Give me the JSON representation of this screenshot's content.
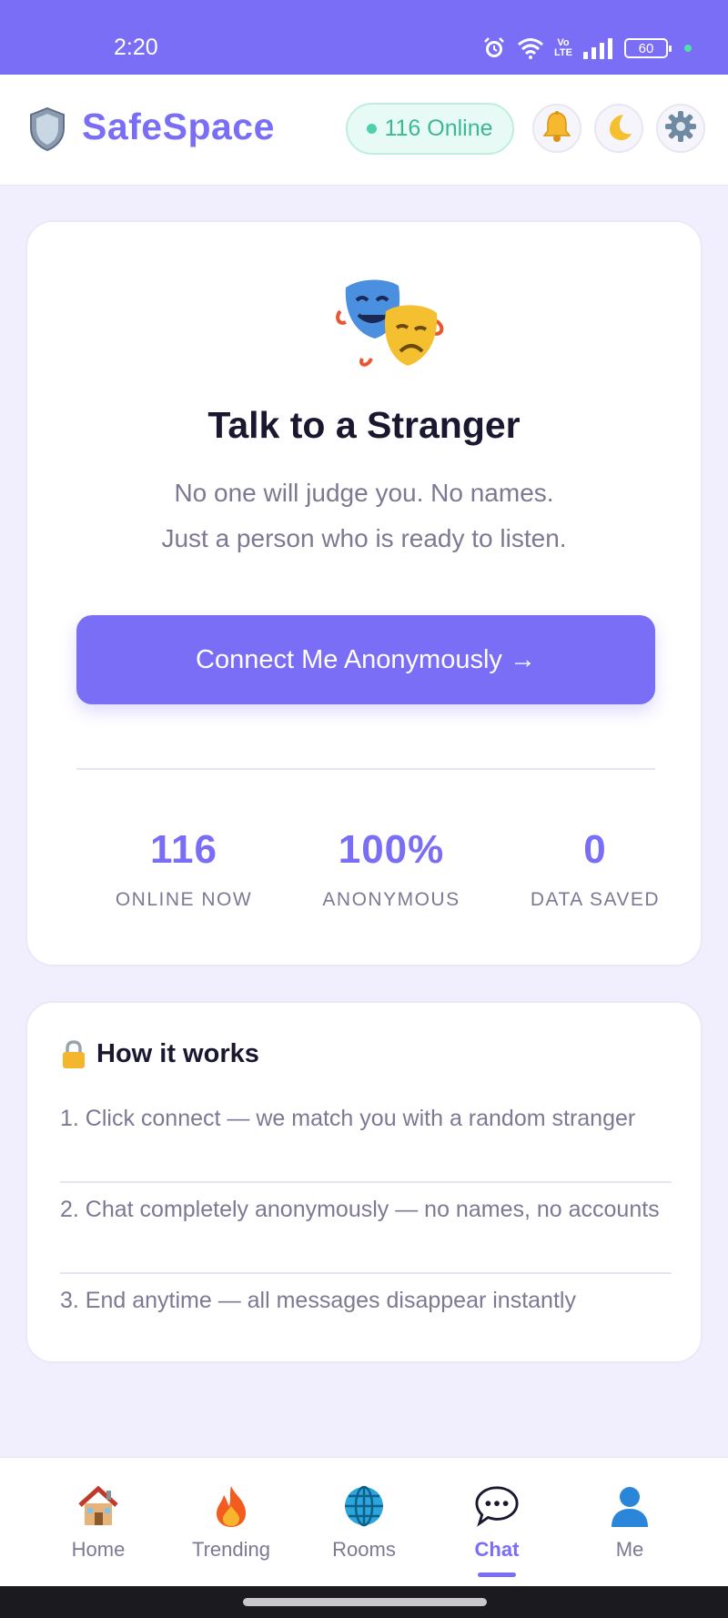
{
  "status_bar": {
    "time": "2:20",
    "network_label": "Vo\nLTE",
    "battery": "60",
    "icons": [
      "alarm-icon",
      "wifi-icon",
      "volte-icon",
      "signal-icon",
      "battery-icon"
    ]
  },
  "header": {
    "brand": "SafeSpace",
    "brand_icon": "shield-icon",
    "online_badge": "116 Online",
    "buttons": [
      "bell-icon",
      "moon-icon",
      "gear-icon"
    ]
  },
  "hero": {
    "icon": "theater-masks-icon",
    "title": "Talk to a Stranger",
    "subtitle_line1": "No one will judge you. No names.",
    "subtitle_line2": "Just a person who is ready to listen.",
    "connect_label": "Connect Me Anonymously →",
    "stats": [
      {
        "value": "116",
        "label": "ONLINE NOW"
      },
      {
        "value": "100%",
        "label": "ANONYMOUS"
      },
      {
        "value": "0",
        "label": "DATA SAVED"
      }
    ]
  },
  "how_it_works": {
    "icon": "lock-icon",
    "title": "How it works",
    "steps": [
      "1. Click connect — we match you with a random stranger",
      "2. Chat completely anonymously — no names, no accounts",
      "3. End anytime — all messages disappear instantly"
    ]
  },
  "bottom_nav": {
    "items": [
      {
        "label": "Home",
        "icon": "house-icon"
      },
      {
        "label": "Trending",
        "icon": "fire-icon"
      },
      {
        "label": "Rooms",
        "icon": "globe-icon"
      },
      {
        "label": "Chat",
        "icon": "speech-bubble-icon"
      },
      {
        "label": "Me",
        "icon": "person-icon"
      }
    ],
    "active": "Chat"
  },
  "colors": {
    "accent": "#7b6ef6",
    "online_green": "#3cb896",
    "background": "#f1effd",
    "muted_text": "#7c7a93"
  }
}
